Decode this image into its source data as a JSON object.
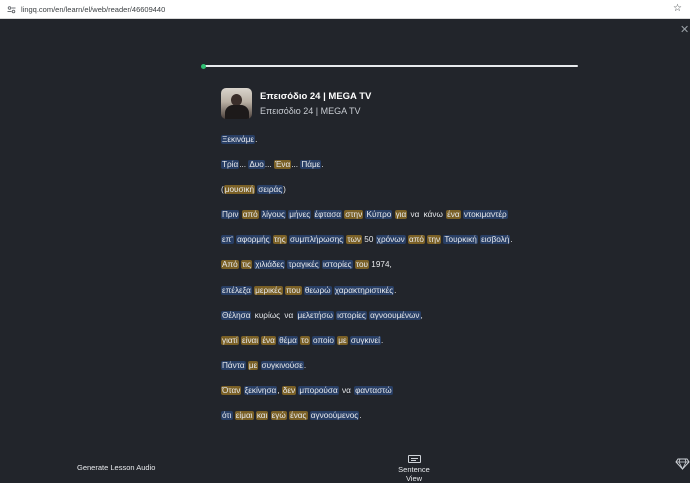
{
  "browser": {
    "url": "lingq.com/en/learn/el/web/reader/46609440",
    "site_icon": "site-settings-icon",
    "bookmark_icon": "star-icon"
  },
  "reader": {
    "progress_fraction": 0.0,
    "progress_color": "#2fbf71"
  },
  "lesson": {
    "title": "Επεισόδιο 24 | MEGA TV",
    "subtitle": "Επεισόδιο 24 | MEGA TV"
  },
  "colors": {
    "background": "#22252b",
    "new_word_highlight": "#283e64",
    "lingq_highlight": "#7a6026"
  },
  "lines": [
    [
      {
        "t": "Ξεκινάμε",
        "s": "blue"
      },
      {
        "t": ".",
        "s": "plain"
      }
    ],
    [
      {
        "t": "Τρία",
        "s": "blue"
      },
      {
        "t": "... ",
        "s": "plain"
      },
      {
        "t": "Δυο",
        "s": "blue"
      },
      {
        "t": "... ",
        "s": "plain"
      },
      {
        "t": "Ένα",
        "s": "yellow"
      },
      {
        "t": "... ",
        "s": "plain"
      },
      {
        "t": "Πάμε",
        "s": "blue"
      },
      {
        "t": ".",
        "s": "plain"
      }
    ],
    [
      {
        "t": "(",
        "s": "plain"
      },
      {
        "t": "μουσική",
        "s": "yellow"
      },
      {
        "t": " ",
        "s": "plain"
      },
      {
        "t": "σειράς",
        "s": "blue"
      },
      {
        "t": ")",
        "s": "plain"
      }
    ],
    [
      {
        "t": "Πριν",
        "s": "blue"
      },
      {
        "t": " ",
        "s": "plain"
      },
      {
        "t": "από",
        "s": "yellow"
      },
      {
        "t": " ",
        "s": "plain"
      },
      {
        "t": "λίγους",
        "s": "blue"
      },
      {
        "t": " ",
        "s": "plain"
      },
      {
        "t": "μήνες",
        "s": "blue"
      },
      {
        "t": " ",
        "s": "plain"
      },
      {
        "t": "έφτασα",
        "s": "blue"
      },
      {
        "t": " ",
        "s": "plain"
      },
      {
        "t": "στην",
        "s": "yellow"
      },
      {
        "t": " ",
        "s": "plain"
      },
      {
        "t": "Κύπρο",
        "s": "blue"
      },
      {
        "t": " ",
        "s": "plain"
      },
      {
        "t": "για",
        "s": "yellow"
      },
      {
        "t": " ",
        "s": "plain"
      },
      {
        "t": "να",
        "s": "plain"
      },
      {
        "t": " ",
        "s": "plain"
      },
      {
        "t": "κάνω",
        "s": "plain"
      },
      {
        "t": " ",
        "s": "plain"
      },
      {
        "t": "ένα",
        "s": "yellow"
      },
      {
        "t": " ",
        "s": "plain"
      },
      {
        "t": "ντοκιμαντέρ",
        "s": "blue"
      }
    ],
    [
      {
        "t": "επ'",
        "s": "blue"
      },
      {
        "t": " ",
        "s": "plain"
      },
      {
        "t": "αφορμής",
        "s": "blue"
      },
      {
        "t": " ",
        "s": "plain"
      },
      {
        "t": "της",
        "s": "yellow"
      },
      {
        "t": " ",
        "s": "plain"
      },
      {
        "t": "συμπλήρωσης",
        "s": "blue"
      },
      {
        "t": " ",
        "s": "plain"
      },
      {
        "t": "των",
        "s": "yellow"
      },
      {
        "t": " 50 ",
        "s": "plain"
      },
      {
        "t": "χρόνων",
        "s": "blue"
      },
      {
        "t": " ",
        "s": "plain"
      },
      {
        "t": "από",
        "s": "yellow"
      },
      {
        "t": " ",
        "s": "plain"
      },
      {
        "t": "την",
        "s": "yellow"
      },
      {
        "t": " ",
        "s": "plain"
      },
      {
        "t": "Τουρκική",
        "s": "blue"
      },
      {
        "t": " ",
        "s": "plain"
      },
      {
        "t": "εισβολή",
        "s": "blue"
      },
      {
        "t": ".",
        "s": "plain"
      }
    ],
    [
      {
        "t": "Από",
        "s": "yellow"
      },
      {
        "t": " ",
        "s": "plain"
      },
      {
        "t": "τις",
        "s": "yellow"
      },
      {
        "t": " ",
        "s": "plain"
      },
      {
        "t": "χιλιάδες",
        "s": "blue"
      },
      {
        "t": " ",
        "s": "plain"
      },
      {
        "t": "τραγικές",
        "s": "blue"
      },
      {
        "t": " ",
        "s": "plain"
      },
      {
        "t": "ιστορίες",
        "s": "blue"
      },
      {
        "t": " ",
        "s": "plain"
      },
      {
        "t": "του",
        "s": "yellow"
      },
      {
        "t": " 1974,",
        "s": "plain"
      }
    ],
    [
      {
        "t": "επέλεξα",
        "s": "blue"
      },
      {
        "t": " ",
        "s": "plain"
      },
      {
        "t": "μερικές",
        "s": "yellow"
      },
      {
        "t": " ",
        "s": "plain"
      },
      {
        "t": "που",
        "s": "yellow"
      },
      {
        "t": " ",
        "s": "plain"
      },
      {
        "t": "θεωρώ",
        "s": "blue"
      },
      {
        "t": " ",
        "s": "plain"
      },
      {
        "t": "χαρακτηριστικές",
        "s": "blue"
      },
      {
        "t": ".",
        "s": "plain"
      }
    ],
    [
      {
        "t": "Θέλησα",
        "s": "blue"
      },
      {
        "t": " ",
        "s": "plain"
      },
      {
        "t": "κυρίως",
        "s": "plain"
      },
      {
        "t": " ",
        "s": "plain"
      },
      {
        "t": "να",
        "s": "plain"
      },
      {
        "t": " ",
        "s": "plain"
      },
      {
        "t": "μελετήσω",
        "s": "blue"
      },
      {
        "t": " ",
        "s": "plain"
      },
      {
        "t": "ιστορίες",
        "s": "blue"
      },
      {
        "t": " ",
        "s": "plain"
      },
      {
        "t": "αγνοουμένων",
        "s": "blue"
      },
      {
        "t": ",",
        "s": "plain"
      }
    ],
    [
      {
        "t": "γιατί",
        "s": "yellow"
      },
      {
        "t": " ",
        "s": "plain"
      },
      {
        "t": "είναι",
        "s": "yellow"
      },
      {
        "t": " ",
        "s": "plain"
      },
      {
        "t": "ένα",
        "s": "yellow"
      },
      {
        "t": " ",
        "s": "plain"
      },
      {
        "t": "θέμα",
        "s": "blue"
      },
      {
        "t": " ",
        "s": "plain"
      },
      {
        "t": "το",
        "s": "yellow"
      },
      {
        "t": " ",
        "s": "plain"
      },
      {
        "t": "οποίο",
        "s": "blue"
      },
      {
        "t": " ",
        "s": "plain"
      },
      {
        "t": "με",
        "s": "yellow"
      },
      {
        "t": " ",
        "s": "plain"
      },
      {
        "t": "συγκινεί",
        "s": "blue"
      },
      {
        "t": ".",
        "s": "plain"
      }
    ],
    [
      {
        "t": "Πάντα",
        "s": "blue"
      },
      {
        "t": " ",
        "s": "plain"
      },
      {
        "t": "με",
        "s": "yellow"
      },
      {
        "t": " ",
        "s": "plain"
      },
      {
        "t": "συγκινούσε",
        "s": "blue"
      },
      {
        "t": ".",
        "s": "plain"
      }
    ],
    [
      {
        "t": "Όταν",
        "s": "yellow"
      },
      {
        "t": " ",
        "s": "plain"
      },
      {
        "t": "ξεκίνησα",
        "s": "blue"
      },
      {
        "t": ", ",
        "s": "plain"
      },
      {
        "t": "δεν",
        "s": "yellow"
      },
      {
        "t": " ",
        "s": "plain"
      },
      {
        "t": "μπορούσα",
        "s": "blue"
      },
      {
        "t": " ",
        "s": "plain"
      },
      {
        "t": "να",
        "s": "plain"
      },
      {
        "t": " ",
        "s": "plain"
      },
      {
        "t": "φανταστώ",
        "s": "blue"
      }
    ],
    [
      {
        "t": "ότι",
        "s": "blue"
      },
      {
        "t": " ",
        "s": "plain"
      },
      {
        "t": "είμαι",
        "s": "yellow"
      },
      {
        "t": " ",
        "s": "plain"
      },
      {
        "t": "και",
        "s": "yellow"
      },
      {
        "t": " ",
        "s": "plain"
      },
      {
        "t": "εγώ",
        "s": "yellow"
      },
      {
        "t": " ",
        "s": "plain"
      },
      {
        "t": "ένας",
        "s": "yellow"
      },
      {
        "t": " ",
        "s": "plain"
      },
      {
        "t": "αγνοούμενος",
        "s": "blue"
      },
      {
        "t": ".",
        "s": "plain"
      }
    ]
  ],
  "footer": {
    "generate_audio_label": "Generate Lesson Audio",
    "sentence_view_label": "Sentence View",
    "sentence_view_icon": "sentence-view-icon",
    "corner_icon": "lingq-gem-icon"
  }
}
